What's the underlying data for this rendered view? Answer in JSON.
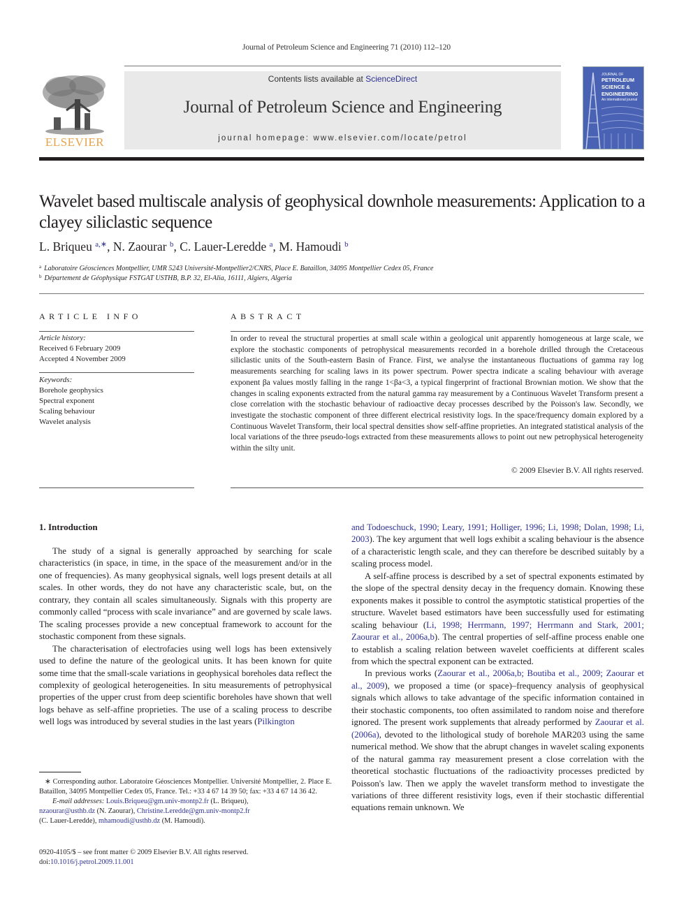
{
  "header": {
    "running_head": "Journal of Petroleum Science and Engineering 71 (2010) 112–120",
    "contents_prefix": "Contents lists available at ",
    "contents_link": "ScienceDirect",
    "journal_name": "Journal of Petroleum Science and Engineering",
    "homepage": "journal homepage: www.elsevier.com/locate/petrol",
    "publisher_logo_text": "ELSEVIER",
    "cover": {
      "line1": "JOURNAL OF",
      "line2": "PETROLEUM",
      "line3": "SCIENCE &",
      "line4": "ENGINEERING",
      "tagline": "An international journal"
    }
  },
  "article": {
    "title": "Wavelet based multiscale analysis of geophysical downhole measurements: Application to a clayey siliclastic sequence",
    "authors": [
      {
        "name": "L. Briqueu",
        "sup": "a,∗"
      },
      {
        "name": "N. Zaourar",
        "sup": "b"
      },
      {
        "name": "C. Lauer-Leredde",
        "sup": "a"
      },
      {
        "name": "M. Hamoudi",
        "sup": "b"
      }
    ],
    "affiliations": [
      {
        "mark": "a",
        "text": "Laboratoire Géosciences Montpellier, UMR 5243 Université-Montpellier2/CNRS, Place E. Bataillon, 34095 Montpellier Cedex 05, France"
      },
      {
        "mark": "b",
        "text": "Département de Géophysique FSTGAT USTHB, B.P. 32, El-Alia, 16111, Algiers, Algeria"
      }
    ]
  },
  "article_info": {
    "heading": "ARTICLE INFO",
    "history_label": "Article history:",
    "received": "Received 6 February 2009",
    "accepted": "Accepted 4 November 2009",
    "keywords_label": "Keywords:",
    "keywords": [
      "Borehole geophysics",
      "Spectral exponent",
      "Scaling behaviour",
      "Wavelet analysis"
    ]
  },
  "abstract": {
    "heading": "ABSTRACT",
    "text": "In order to reveal the structural properties at small scale within a geological unit apparently homogeneous at large scale, we explore the stochastic components of petrophysical measurements recorded in a borehole drilled through the Cretaceous siliclastic units of the South-eastern Basin of France. First, we analyse the instantaneous fluctuations of gamma ray log measurements searching for scaling laws in its power spectrum. Power spectra indicate a scaling behaviour with average exponent βa values mostly falling in the range 1<βa<3, a typical fingerprint of fractional Brownian motion. We show that the changes in scaling exponents extracted from the natural gamma ray measurement by a Continuous Wavelet Transform present a close correlation with the stochastic behaviour of radioactive decay processes described by the Poisson's law. Secondly, we investigate the stochastic component of three different electrical resistivity logs. In the space/frequency domain explored by a Continuous Wavelet Transform, their local spectral densities show self-affine proprieties. An integrated statistical analysis of the local variations of the three pseudo-logs extracted from these measurements allows to point out new petrophysical heterogeneity within the silty unit.",
    "copyright": "© 2009 Elsevier B.V. All rights reserved."
  },
  "body": {
    "section_heading": "1. Introduction",
    "left_col": {
      "p1": "The study of a signal is generally approached by searching for scale characteristics (in space, in time, in the space of the measurement and/or in the one of frequencies). As many geophysical signals, well logs present details at all scales. In other words, they do not have any characteristic scale, but, on the contrary, they contain all scales simultaneously. Signals with this property are commonly called “process with scale invariance” and are governed by scale laws. The scaling processes provide a new conceptual framework to account for the stochastic component from these signals.",
      "p2_text": "The characterisation of electrofacies using well logs has been extensively used to define the nature of the geological units. It has been known for quite some time that the small-scale variations in geophysical boreholes data reflect the complexity of geological heterogeneities. In situ measurements of petrophysical properties of the upper crust from deep scientific boreholes have shown that well logs behave as self-affine proprieties. The use of a scaling process to describe well logs was introduced by several studies in the last years (",
      "p2_link": "Pilkington"
    },
    "right_col": {
      "p1_links": "and Todoeschuck, 1990; Leary, 1991; Holliger, 1996; Li, 1998; Dolan, 1998; Li, 2003",
      "p1_text": "). The key argument that well logs exhibit a scaling behaviour is the absence of a characteristic length scale, and they can therefore be described suitably by a scaling process model.",
      "p2_a": "A self-affine process is described by a set of spectral exponents estimated by the slope of the spectral density decay in the frequency domain. Knowing these exponents makes it possible to control the asymptotic statistical properties of the structure. Wavelet based estimators have been successfully used for estimating scaling behaviour (",
      "p2_links": "Li, 1998; Herrmann, 1997; Herrmann and Stark, 2001; Zaourar et al., 2006a,b",
      "p2_b": "). The central properties of self-affine process enable one to establish a scaling relation between wavelet coefficients at different scales from which the spectral exponent can be extracted.",
      "p3_a": "In previous works (",
      "p3_links": "Zaourar et al., 2006a,b; Boutiba et al., 2009; Zaourar et al., 2009",
      "p3_b": "), we proposed a time (or space)–frequency analysis of geophysical signals which allows to take advantage of the specific information contained in their stochastic components, too often assimilated to random noise and therefore ignored. The present work supplements that already performed by ",
      "p3_link2": "Zaourar et al. (2006a)",
      "p3_c": ", devoted to the lithological study of borehole MAR203 using the same numerical method. We show that the abrupt changes in wavelet scaling exponents of the natural gamma ray measurement present a close correlation with the theoretical stochastic fluctuations of the radioactivity processes predicted by Poisson's law. Then we apply the wavelet transform method to investigate the variations of three different resistivity logs, even if their stochastic differential equations remain unknown. We"
    }
  },
  "footnotes": {
    "corresponding": "∗ Corresponding author. Laboratoire Géosciences Montpellier. Université Montpellier, 2. Place E. Bataillon, 34095 Montpellier Cedex 05, France. Tel.: +33 4 67 14 39 50; fax: +33 4 67 14 36 42.",
    "email_label": "E-mail addresses:",
    "emails": [
      {
        "addr": "Louis.Briqueu@gm.univ-montp2.fr",
        "who": " (L. Briqueu),"
      },
      {
        "addr": "nzaourar@usthb.dz",
        "who": " (N. Zaourar), "
      },
      {
        "addr": "Christine.Leredde@gm.univ-montp2.fr",
        "who": ""
      },
      {
        "addr": "mhamoudi@usthb.dz",
        "who": " (M. Hamoudi)."
      }
    ],
    "email3_who": "(C. Lauer-Leredde), ",
    "front_matter": "0920-4105/$ – see front matter © 2009 Elsevier B.V. All rights reserved.",
    "doi_label": "doi:",
    "doi": "10.1016/j.petrol.2009.11.001"
  },
  "colors": {
    "link": "#2e3192",
    "banner_bg": "#e9e9e9",
    "elsevier_orange": "#e8a34a"
  }
}
